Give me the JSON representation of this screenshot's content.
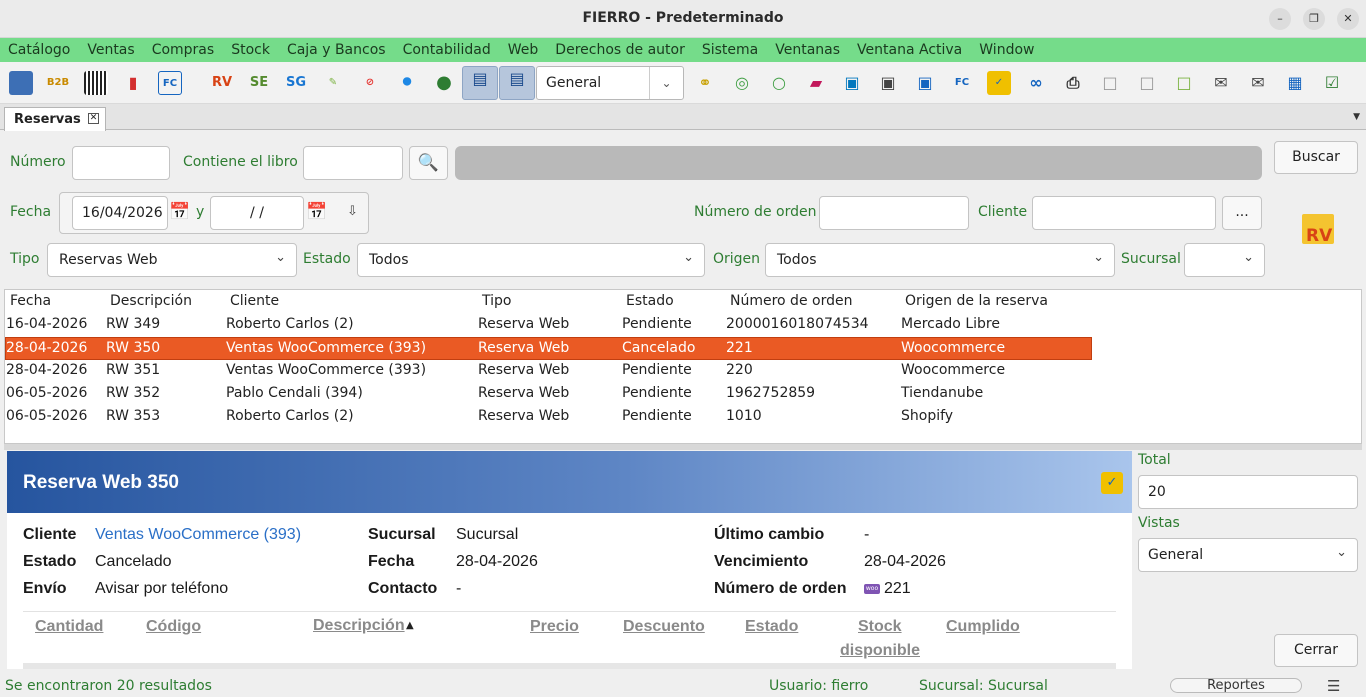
{
  "window": {
    "title": "FIERRO - Predeterminado"
  },
  "menu": [
    "Catálogo",
    "Ventas",
    "Compras",
    "Stock",
    "Caja y Bancos",
    "Contabilidad",
    "Web",
    "Derechos de autor",
    "Sistema",
    "Ventanas",
    "Ventana Activa",
    "Window"
  ],
  "toolbar": {
    "view_select": "General",
    "icons": [
      "book-icon",
      "b2b-icon",
      "barcode-icon",
      "truck-icon",
      "fc-icon",
      "rv-icon",
      "se-icon",
      "sg-icon",
      "edit-doc-icon",
      "cancel-doc-icon",
      "shield-icon",
      "globe-icon",
      "layout-top-icon",
      "layout-split-icon",
      "rings-icon",
      "circle-icon",
      "ring-arrow-icon",
      "eraser-icon",
      "folder-blue-icon",
      "cashbox-icon",
      "bank-icon",
      "fc-invoice-icon",
      "woo-icon",
      "paperclip-icon",
      "printer-icon",
      "blank-doc-icon",
      "add-doc-icon",
      "excel-doc-icon",
      "mail-icon",
      "mail-open-icon",
      "tag-icon",
      "calendar-check-icon"
    ]
  },
  "tab": {
    "label": "Reservas"
  },
  "filters": {
    "numero_label": "Número",
    "numero_value": "",
    "libro_label": "Contiene el libro",
    "libro_value": "",
    "buscar_label": "Buscar",
    "fecha_label": "Fecha",
    "fecha_desde": "16/04/2026",
    "y_label": "y",
    "fecha_hasta": "/ /",
    "orden_label": "Número de orden",
    "orden_value": "",
    "cliente_label": "Cliente",
    "cliente_value": "",
    "more_label": "...",
    "tipo_label": "Tipo",
    "tipo_value": "Reservas Web",
    "estado_label": "Estado",
    "estado_value": "Todos",
    "origen_label": "Origen",
    "origen_value": "Todos",
    "sucursal_label": "Sucursal",
    "sucursal_value": ""
  },
  "badge": {
    "text": "RV"
  },
  "table": {
    "columns": [
      "Fecha",
      "Descripción",
      "Cliente",
      "Tipo",
      "Estado",
      "Número de orden",
      "Origen de la reserva"
    ],
    "rows": [
      [
        "16-04-2026",
        "RW 349",
        "Roberto Carlos (2)",
        "Reserva Web",
        "Pendiente",
        "2000016018074534",
        "Mercado Libre"
      ],
      [
        "28-04-2026",
        "RW 350",
        "Ventas WooCommerce (393)",
        "Reserva Web",
        "Cancelado",
        "221",
        "Woocommerce"
      ],
      [
        "28-04-2026",
        "RW 351",
        "Ventas WooCommerce (393)",
        "Reserva Web",
        "Pendiente",
        "220",
        "Woocommerce"
      ],
      [
        "06-05-2026",
        "RW 352",
        "Pablo Cendali (394)",
        "Reserva Web",
        "Pendiente",
        "1962752859",
        "Tiendanube"
      ],
      [
        "06-05-2026",
        "RW 353",
        "Roberto Carlos (2)",
        "Reserva Web",
        "Pendiente",
        "1010",
        "Shopify"
      ]
    ],
    "selected_index": 1
  },
  "detail": {
    "title": "Reserva Web 350",
    "cliente_label": "Cliente",
    "cliente_value": "Ventas WooCommerce (393)",
    "estado_label": "Estado",
    "estado_value": "Cancelado",
    "envio_label": "Envío",
    "envio_value": "Avisar por teléfono",
    "sucursal_label": "Sucursal",
    "sucursal_value": "Sucursal",
    "fecha_label": "Fecha",
    "fecha_value": "28-04-2026",
    "contacto_label": "Contacto",
    "contacto_value": "-",
    "ultimo_label": "Último cambio",
    "ultimo_value": "-",
    "venc_label": "Vencimiento",
    "venc_value": "28-04-2026",
    "orden_label": "Número de orden",
    "orden_value": "221",
    "woo_text": "woo",
    "items_columns": [
      "Cantidad",
      "Código",
      "Descripción",
      "Precio",
      "Descuento",
      "Estado",
      "Stock",
      "disponible",
      "Cumplido"
    ]
  },
  "side": {
    "total_label": "Total",
    "total_value": "20",
    "vistas_label": "Vistas",
    "vistas_value": "General",
    "cerrar_label": "Cerrar"
  },
  "status": {
    "results": "Se encontraron 20 resultados",
    "usuario": "Usuario: fierro",
    "sucursal": "Sucursal: Sucursal",
    "reportes": "Reportes"
  },
  "colors": {
    "menubar": "#75dc8a",
    "selection": "#ea5a24",
    "label_green": "#2e7d32",
    "banner_start": "#26559f",
    "banner_end": "#a9c5ec"
  }
}
